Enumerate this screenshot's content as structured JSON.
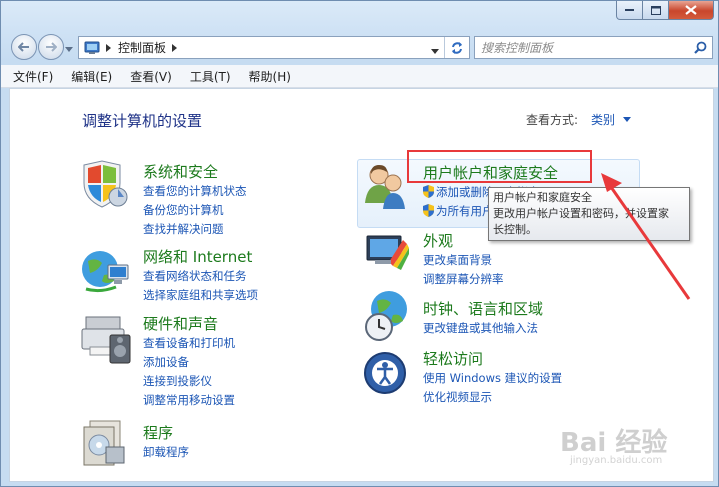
{
  "window": {
    "colors": {
      "accent": "#1c56b5",
      "heading": "#1c7a1c",
      "annotation": "#e8393b"
    }
  },
  "address": {
    "crumb": "控制面板"
  },
  "search": {
    "placeholder": "搜索控制面板"
  },
  "menu": [
    "文件(F)",
    "编辑(E)",
    "查看(V)",
    "工具(T)",
    "帮助(H)"
  ],
  "page": {
    "title": "调整计算机的设置",
    "view_by_label": "查看方式:",
    "view_by_value": "类别"
  },
  "categories": [
    {
      "title": "系统和安全",
      "links": [
        "查看您的计算机状态",
        "备份您的计算机",
        "查找并解决问题"
      ]
    },
    {
      "title": "网络和 Internet",
      "links": [
        "查看网络状态和任务",
        "选择家庭组和共享选项"
      ]
    },
    {
      "title": "硬件和声音",
      "links": [
        "查看设备和打印机",
        "添加设备",
        "连接到投影仪",
        "调整常用移动设置"
      ]
    },
    {
      "title": "程序",
      "links": [
        "卸载程序"
      ]
    },
    {
      "title": "用户帐户和家庭安全",
      "links": [
        "添加或删除用户帐户",
        "为所有用户设置家长控制"
      ]
    },
    {
      "title": "外观",
      "links": [
        "更改桌面背景",
        "调整屏幕分辨率"
      ]
    },
    {
      "title": "时钟、语言和区域",
      "links": [
        "更改键盘或其他输入法"
      ]
    },
    {
      "title": "轻松访问",
      "links": [
        "使用 Windows 建议的设置",
        "优化视频显示"
      ]
    }
  ],
  "tooltip": {
    "line1": "用户帐户和家庭安全",
    "line2": "更改用户帐户设置和密码，并设置家",
    "line3": "长控制。"
  },
  "watermark": {
    "text": "Bai 经验",
    "sub": "jingyan.baidu.com"
  },
  "icons": [
    "back-icon",
    "forward-icon",
    "control-panel-icon",
    "refresh-icon",
    "search-icon",
    "shield-icon"
  ]
}
